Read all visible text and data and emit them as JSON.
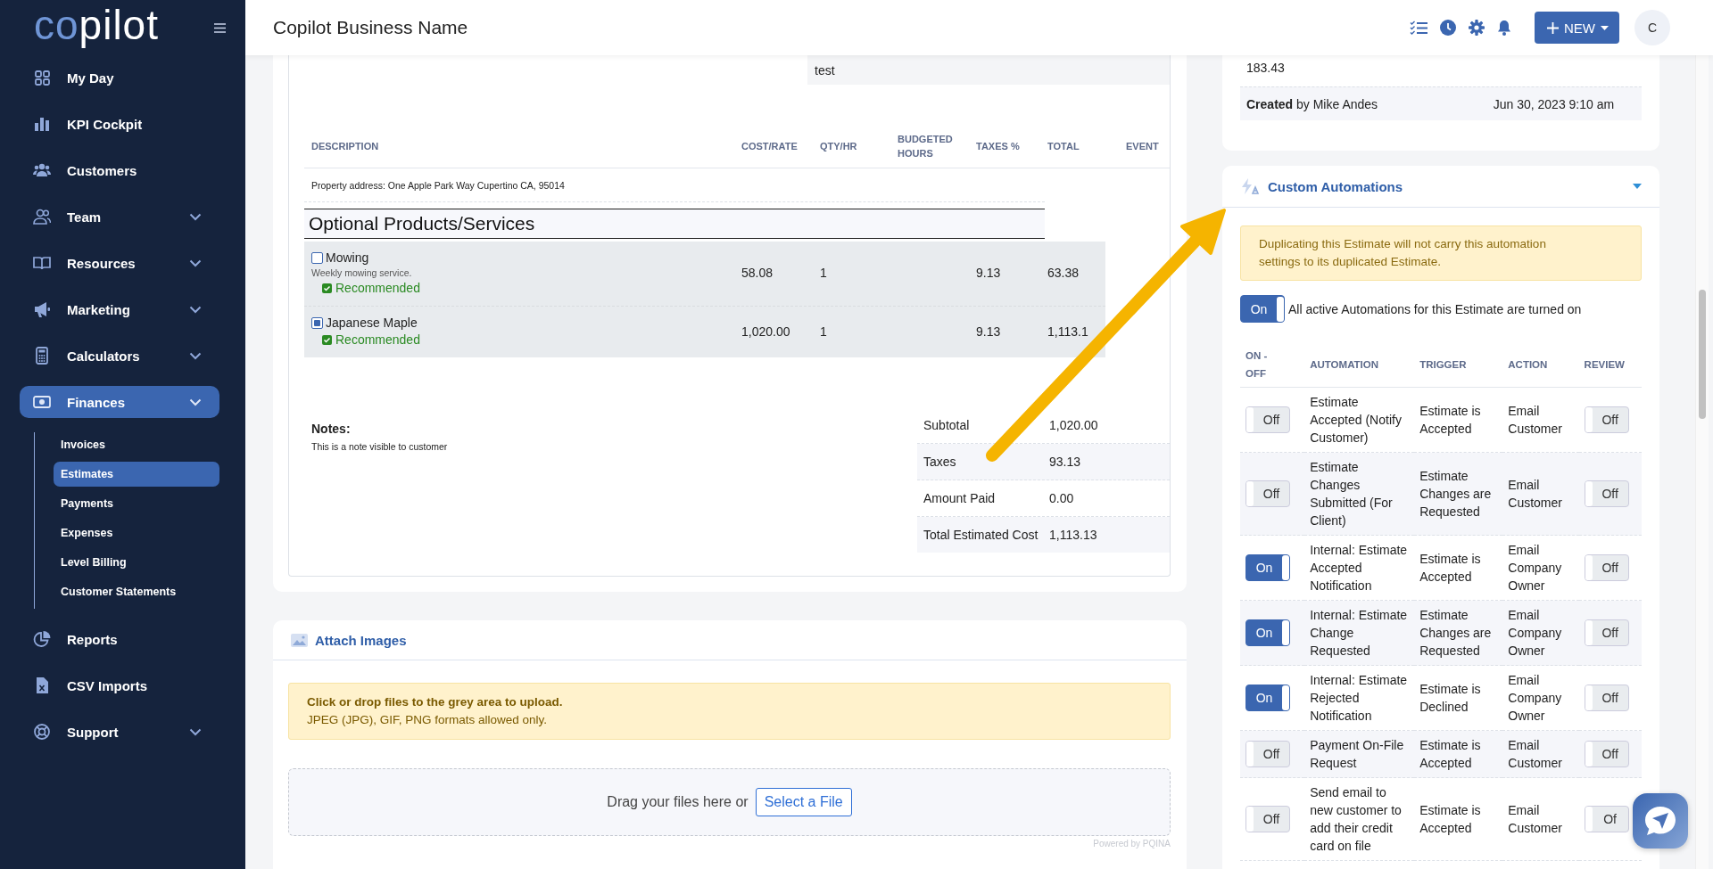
{
  "sidebar": {
    "logo": {
      "part_1": "co",
      "part_2": "pilot"
    },
    "items": [
      {
        "label": "My Day",
        "selected": false,
        "has_submenu": false
      },
      {
        "label": "KPI Cockpit",
        "selected": false,
        "has_submenu": false
      },
      {
        "label": "Customers",
        "selected": false,
        "has_submenu": false
      },
      {
        "label": "Team",
        "selected": false,
        "has_submenu": true
      },
      {
        "label": "Resources",
        "selected": false,
        "has_submenu": true
      },
      {
        "label": "Marketing",
        "selected": false,
        "has_submenu": true
      },
      {
        "label": "Calculators",
        "selected": false,
        "has_submenu": true
      },
      {
        "label": "Finances",
        "selected": true,
        "has_submenu": true,
        "children": [
          {
            "label": "Invoices",
            "selected": false
          },
          {
            "label": "Estimates",
            "selected": true
          },
          {
            "label": "Payments",
            "selected": false
          },
          {
            "label": "Expenses",
            "selected": false
          },
          {
            "label": "Level Billing",
            "selected": false
          },
          {
            "label": "Customer Statements",
            "selected": false
          }
        ]
      },
      {
        "label": "Reports",
        "selected": false,
        "has_submenu": false
      },
      {
        "label": "CSV Imports",
        "selected": false,
        "has_submenu": false
      },
      {
        "label": "Support",
        "selected": false,
        "has_submenu": true
      }
    ]
  },
  "header": {
    "title": "Copilot Business Name",
    "new_button": "NEW",
    "avatar": "C"
  },
  "estimate": {
    "test_value": "test",
    "columns": [
      "DESCRIPTION",
      "COST/RATE",
      "QTY/HR",
      "BUDGETED HOURS",
      "TAXES %",
      "TOTAL",
      "EVENT"
    ],
    "property_address": "Property address: One Apple Park Way Cupertino CA, 95014",
    "section_title": "Optional Products/Services",
    "items": [
      {
        "name": "Mowing",
        "description": "Weekly mowing service.",
        "checked": false,
        "tag": "Recommended",
        "cost_rate": "58.08",
        "qty_hr": "1",
        "taxes": "9.13",
        "total": "63.38"
      },
      {
        "name": "Japanese Maple",
        "checked": true,
        "tag": "Recommended",
        "cost_rate": "1,020.00",
        "qty_hr": "1",
        "taxes": "9.13",
        "total": "1,113.1"
      }
    ],
    "notes_label": "Notes:",
    "notes": "This is a note visible to customer",
    "totals": [
      {
        "label": "Subtotal",
        "value": "1,020.00"
      },
      {
        "label": "Taxes",
        "value": "93.13"
      },
      {
        "label": "Amount Paid",
        "value": "0.00"
      },
      {
        "label": "Total Estimated Cost",
        "value": "1,113.13"
      }
    ]
  },
  "attach_images": {
    "title": "Attach Images",
    "notice_title": "Click or drop files to the grey area to upload.",
    "notice_text": "JPEG (JPG), GIF, PNG formats allowed only.",
    "drop_text": "Drag your files here or",
    "select_button": "Select a File",
    "powered_by": "Powered by PQINA"
  },
  "activity": {
    "amount": "183.43",
    "created": "**Created** by Mike Andes",
    "created_date": "Jun 30, 2023 9:10 am"
  },
  "custom_automations": {
    "title": "Custom Automations",
    "notice": "Duplicating this Estimate will not carry this automation settings to its duplicated Estimate.",
    "master_toggle": {
      "on": true,
      "label": "On"
    },
    "master_text": "All active Automations for this Estimate are turned on",
    "columns": [
      "ON - OFF",
      "AUTOMATION",
      "TRIGGER",
      "ACTION",
      "REVIEW"
    ],
    "rows": [
      {
        "toggle": {
          "on": false,
          "label": "Off"
        },
        "automation": "Estimate Accepted (Notify Customer)",
        "trigger": "Estimate is Accepted",
        "action": "Email Customer",
        "review": {
          "on": false,
          "label": "Off"
        }
      },
      {
        "toggle": {
          "on": false,
          "label": "Off"
        },
        "automation": "Estimate Changes Submitted (For Client)",
        "trigger": "Estimate Changes are Requested",
        "action": "Email Customer",
        "review": {
          "on": false,
          "label": "Off"
        }
      },
      {
        "toggle": {
          "on": true,
          "label": "On"
        },
        "automation": "Internal: Estimate Accepted Notification",
        "trigger": "Estimate is Accepted",
        "action": "Email Company Owner",
        "review": {
          "on": false,
          "label": "Off"
        }
      },
      {
        "toggle": {
          "on": true,
          "label": "On"
        },
        "automation": "Internal: Estimate Change Requested",
        "trigger": "Estimate Changes are Requested",
        "action": "Email Company Owner",
        "review": {
          "on": false,
          "label": "Off"
        }
      },
      {
        "toggle": {
          "on": true,
          "label": "On"
        },
        "automation": "Internal: Estimate Rejected Notification",
        "trigger": "Estimate is Declined",
        "action": "Email Company Owner",
        "review": {
          "on": false,
          "label": "Off"
        }
      },
      {
        "toggle": {
          "on": false,
          "label": "Off"
        },
        "automation": "Payment On-File Request",
        "trigger": "Estimate is Accepted",
        "action": "Email Customer",
        "review": {
          "on": false,
          "label": "Off"
        }
      },
      {
        "toggle": {
          "on": false,
          "label": "Off"
        },
        "automation": "Send email to new customer to add their credit card on file",
        "trigger": "Estimate is Accepted",
        "action": "Email Customer",
        "review": {
          "on": false,
          "label": "Of"
        }
      }
    ]
  }
}
